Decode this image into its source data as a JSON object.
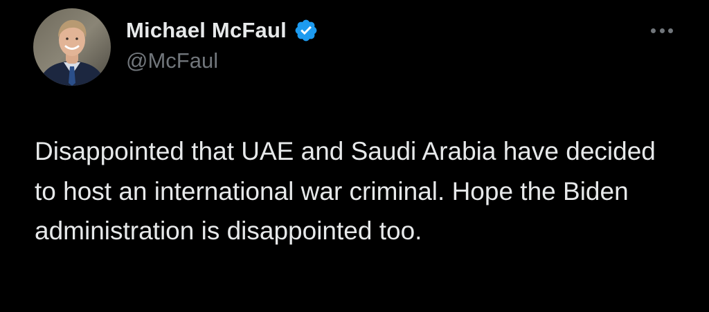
{
  "author": {
    "display_name": "Michael McFaul",
    "handle": "@McFaul",
    "verified": true,
    "avatar_icon": "profile-photo"
  },
  "menu": {
    "icon": "more-horizontal-icon"
  },
  "tweet": {
    "text": "Disappointed that UAE and Saudi Arabia have decided to host an international war criminal. Hope the Biden administration is disappointed too."
  },
  "colors": {
    "background": "#000000",
    "primary_text": "#e7e9ea",
    "secondary_text": "#71767b",
    "verified_badge": "#1d9bf0"
  }
}
